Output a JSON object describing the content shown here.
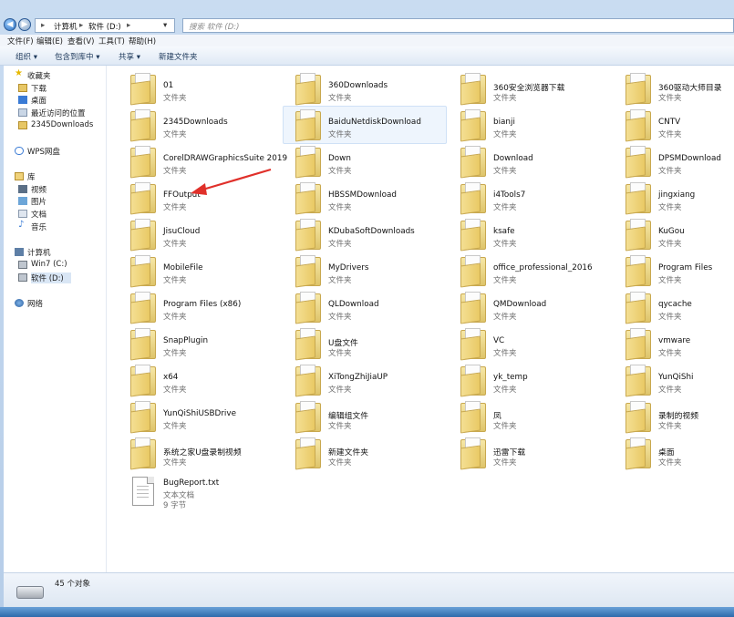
{
  "address": {
    "path": [
      "计算机",
      "软件 (D:)"
    ],
    "search_placeholder": "搜索 软件 (D:)"
  },
  "menu": [
    "文件(F)",
    "编辑(E)",
    "查看(V)",
    "工具(T)",
    "帮助(H)"
  ],
  "toolbar": {
    "organize": "组织 ▾",
    "include": "包含到库中 ▾",
    "share": "共享 ▾",
    "new_folder": "新建文件夹"
  },
  "nav": {
    "favorites": "收藏夹",
    "downloads": "下载",
    "desktop": "桌面",
    "recent": "最近访问的位置",
    "d2345": "2345Downloads",
    "wps": "WPS网盘",
    "libraries": "库",
    "videos": "视频",
    "pictures": "图片",
    "documents": "文档",
    "music": "音乐",
    "computer": "计算机",
    "drive_c": "Win7 (C:)",
    "drive_d": "软件 (D:)",
    "network": "网络"
  },
  "folder_type": "文件夹",
  "folders": [
    "01",
    "360Downloads",
    "360安全浏览器下载",
    "360驱动大师目录",
    "2345Downloads",
    "BaiduNetdiskDownload",
    "bianji",
    "CNTV",
    "CorelDRAWGraphicsSuite 2019",
    "Down",
    "Download",
    "DPSMDownload",
    "FFOutput",
    "HBSSMDownload",
    "i4Tools7",
    "jingxiang",
    "JisuCloud",
    "KDubaSoftDownloads",
    "ksafe",
    "KuGou",
    "MobileFile",
    "MyDrivers",
    "office_professional_2016",
    "Program Files",
    "Program Files (x86)",
    "QLDownload",
    "QMDownload",
    "qycache",
    "SnapPlugin",
    "U盘文件",
    "VC",
    "vmware",
    "x64",
    "XiTongZhiJiaUP",
    "yk_temp",
    "YunQiShi",
    "YunQiShiUSBDrive",
    "编辑组文件",
    "凤",
    "录制的视频",
    "系统之家U盘录制视频",
    "新建文件夹",
    "迅雷下载",
    "桌面"
  ],
  "file": {
    "name": "BugReport.txt",
    "type": "文本文档",
    "size": "9 字节"
  },
  "status": {
    "count": "45 个对象"
  }
}
